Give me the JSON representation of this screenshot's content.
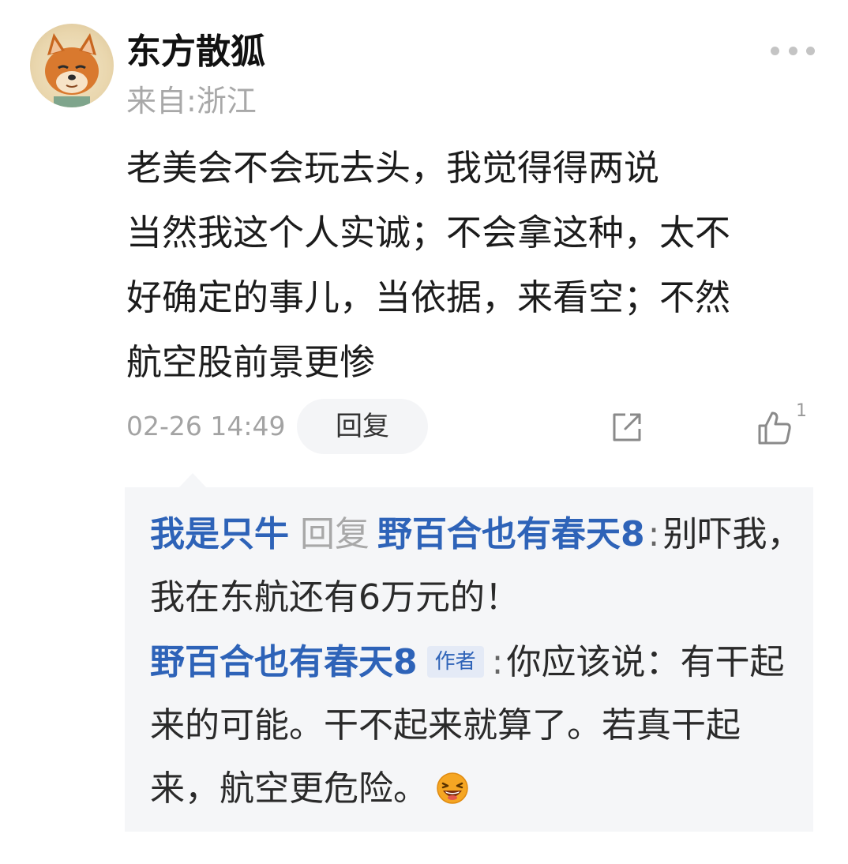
{
  "comment": {
    "author": "东方散狐",
    "location": "来自:浙江",
    "lines": [
      "老美会不会玩去头，我觉得得两说",
      "当然我这个人实诚；不会拿这种，太不",
      "好确定的事儿，当依据，来看空；不然",
      "航空股前景更惨"
    ],
    "timestamp": "02-26 14:49",
    "reply_label": "回复",
    "like_count": "1",
    "avatar_icon": "fox-avatar",
    "more_icon": "more-dots-icon",
    "share_icon": "share-icon",
    "like_icon": "thumbs-up-icon"
  },
  "replies": [
    {
      "user": "我是只牛",
      "reply_word": "回复",
      "target": "野百合也有春天8",
      "colon": ":",
      "text": "别吓我，我在东航还有6万元的！"
    },
    {
      "user": "野百合也有春天8",
      "badge": "作者",
      "colon": ":",
      "text": "你应该说：有干起来的可能。干不起来就算了。若真干起来，航空更危险。",
      "emoji": "laughing-emoji"
    }
  ],
  "colors": {
    "link_blue": "#2e63b8",
    "panel_bg": "#f5f6f8",
    "muted_gray": "#a8a8a8"
  }
}
